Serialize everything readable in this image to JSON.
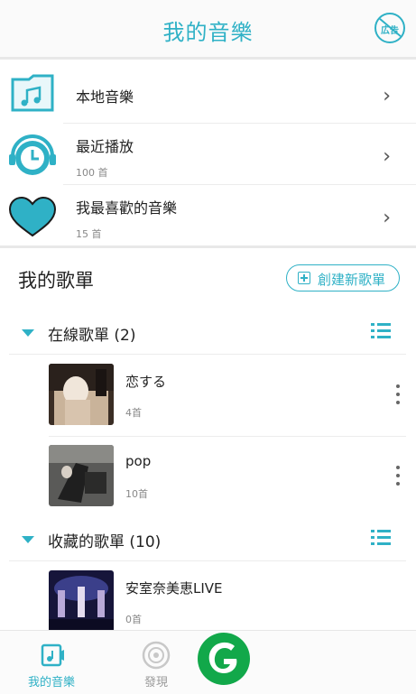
{
  "header": {
    "title": "我的音樂",
    "noad_label": "広告"
  },
  "library": [
    {
      "title": "本地音樂",
      "sub": ""
    },
    {
      "title": "最近播放",
      "sub": "100 首"
    },
    {
      "title": "我最喜歡的音樂",
      "sub": "15 首"
    }
  ],
  "playlists_section": {
    "title": "我的歌單",
    "create_label": "創建新歌單"
  },
  "groups": [
    {
      "title": "在線歌單 (2)",
      "items": [
        {
          "title": "恋する",
          "count": "4首"
        },
        {
          "title": "pop",
          "count": "10首"
        }
      ]
    },
    {
      "title": "收藏的歌單 (10)",
      "items": [
        {
          "title": "安室奈美恵LIVE",
          "count": "0首"
        }
      ]
    }
  ],
  "nav": [
    {
      "label": "我的音樂",
      "active": true
    },
    {
      "label": "發現",
      "active": false
    }
  ],
  "colors": {
    "accent": "#2fb1c6",
    "logo": "#12a84a"
  }
}
